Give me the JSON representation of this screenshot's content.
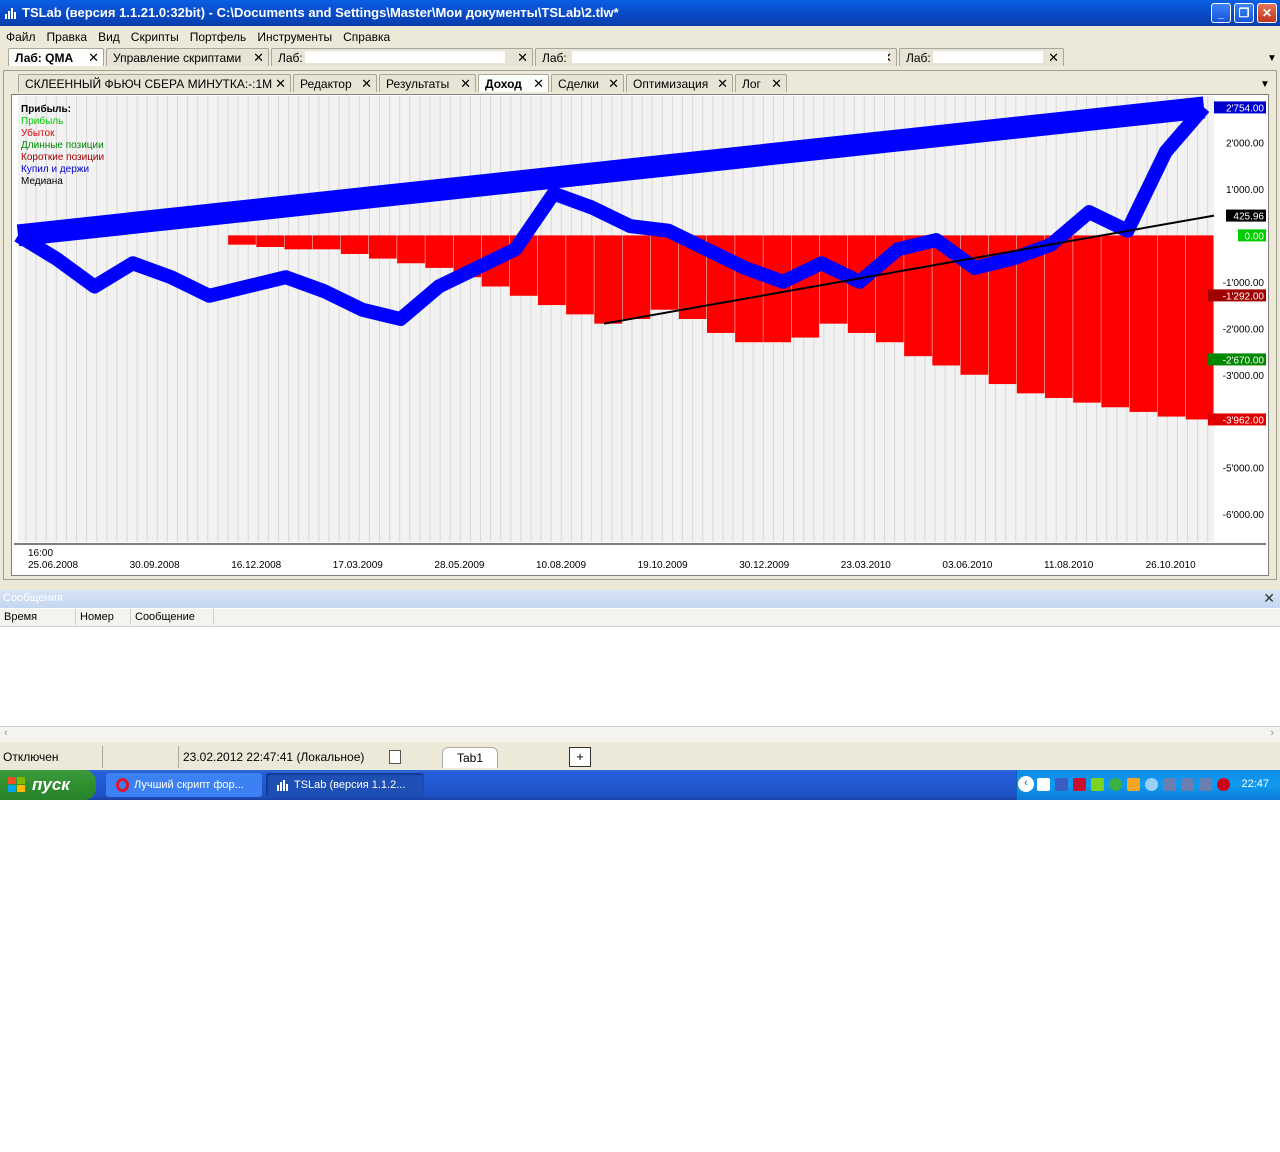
{
  "window": {
    "title": "TSLab (версия 1.1.21.0:32bit) - C:\\Documents and Settings\\Master\\Мои документы\\TSLab\\2.tlw*",
    "min": "_",
    "max": "❐",
    "close": "✕"
  },
  "menu": [
    "Файл",
    "Правка",
    "Вид",
    "Скрипты",
    "Портфель",
    "Инструменты",
    "Справка"
  ],
  "doc_tabs": [
    {
      "label": "Лаб: QMA",
      "active": true
    },
    {
      "label": "Управление скриптами",
      "active": false
    },
    {
      "label": "Лаб:",
      "active": false
    },
    {
      "label": "Лаб:",
      "active": false
    },
    {
      "label": "Лаб:",
      "active": false
    }
  ],
  "inner_tabs": [
    {
      "label": "СКЛЕЕННЫЙ ФЬЮЧ СБЕРА МИНУТКА:-:1M",
      "active": false
    },
    {
      "label": "Редактор",
      "active": false
    },
    {
      "label": "Результаты",
      "active": false
    },
    {
      "label": "Доход",
      "active": true
    },
    {
      "label": "Сделки",
      "active": false
    },
    {
      "label": "Оптимизация",
      "active": false
    },
    {
      "label": "Лог",
      "active": false
    }
  ],
  "legend": {
    "title": "Прибыль:",
    "items": [
      {
        "label": "Прибыль",
        "color": "#00cc00"
      },
      {
        "label": "Убыток",
        "color": "#e00000"
      },
      {
        "label": "Длинные позиции",
        "color": "#008800"
      },
      {
        "label": "Короткие позиции",
        "color": "#a00000"
      },
      {
        "label": "Купил и держи",
        "color": "#0000cc"
      },
      {
        "label": "Медиана",
        "color": "#000000"
      }
    ]
  },
  "chart_data": {
    "type": "area",
    "x_time_label": "16:00",
    "x_ticks": [
      "25.06.2008",
      "30.09.2008",
      "16.12.2008",
      "17.03.2009",
      "28.05.2009",
      "10.08.2009",
      "19.10.2009",
      "30.12.2009",
      "23.03.2010",
      "03.06.2010",
      "11.08.2010",
      "26.10.2010"
    ],
    "y_ticks": [
      2000,
      1000,
      -1000,
      -2000,
      -3000,
      -5000,
      -6000
    ],
    "y_tick_labels": [
      "2'000.00",
      "1'000.00",
      "-1'000.00",
      "-2'000.00",
      "-3'000.00",
      "-5'000.00",
      "-6'000.00"
    ],
    "ylim": [
      -6600,
      3000
    ],
    "value_markers": [
      {
        "value": 2754,
        "label": "2'754.00",
        "bg": "#0000cc",
        "fg": "#ffffff"
      },
      {
        "value": 425.96,
        "label": "425.96",
        "bg": "#000000",
        "fg": "#ffffff"
      },
      {
        "value": 0,
        "label": "0.00",
        "bg": "#00cc00",
        "fg": "#ffffff"
      },
      {
        "value": -1292,
        "label": "-1'292.00",
        "bg": "#a00000",
        "fg": "#ffffff"
      },
      {
        "value": -2670,
        "label": "-2'670.00",
        "bg": "#008800",
        "fg": "#ffffff"
      },
      {
        "value": -3962,
        "label": "-3'962.00",
        "bg": "#e00000",
        "fg": "#ffffff"
      }
    ],
    "series": [
      {
        "name": "Убыток",
        "color": "#ff0000",
        "kind": "bars",
        "values": [
          0,
          -200,
          -250,
          -300,
          -300,
          -400,
          -500,
          -600,
          -700,
          -900,
          -1100,
          -1300,
          -1500,
          -1700,
          -1900,
          -1800,
          -1600,
          -1800,
          -2100,
          -2300,
          -2300,
          -2200,
          -1900,
          -2100,
          -2300,
          -2600,
          -2800,
          -3000,
          -3200,
          -3400,
          -3500,
          -3600,
          -3700,
          -3800,
          -3900,
          -3962
        ]
      },
      {
        "name": "Медиана",
        "color": "#000000",
        "kind": "line",
        "points": [
          [
            0.49,
            -1900
          ],
          [
            1.0,
            425.96
          ]
        ]
      },
      {
        "name": "Купил и держи",
        "color": "#0000ff",
        "kind": "line",
        "values": [
          0,
          -500,
          -1100,
          -600,
          -900,
          -1300,
          -1100,
          -900,
          -1200,
          -1600,
          -1800,
          -1100,
          -700,
          -300,
          900,
          600,
          200,
          100,
          -300,
          -700,
          -1000,
          -600,
          -1000,
          -300,
          -100,
          -700,
          -500,
          -200,
          500,
          100,
          1800,
          2754
        ]
      }
    ]
  },
  "messages": {
    "title": "Сообщения",
    "columns": [
      "Время",
      "Номер",
      "Сообщение"
    ],
    "close": "✕"
  },
  "status": {
    "connection": "Отключен",
    "datetime": "23.02.2012 22:47:41 (Локальное)",
    "tab": "Tab1",
    "add": "+"
  },
  "taskbar": {
    "start": "пуск",
    "items": [
      {
        "label": "Лучший скрипт фор..."
      },
      {
        "label": "TSLab (версия 1.1.2..."
      }
    ],
    "clock": "22:47"
  }
}
